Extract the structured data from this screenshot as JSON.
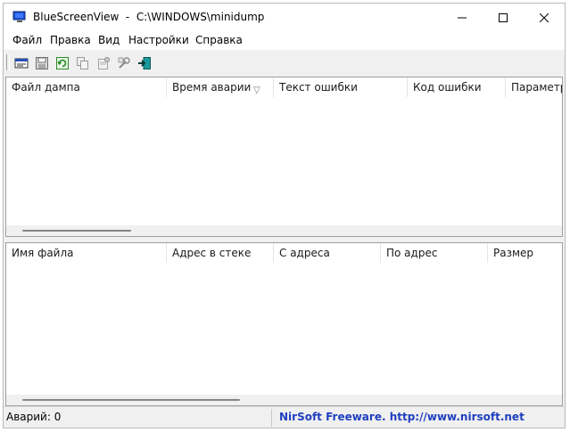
{
  "window": {
    "title": "BlueScreenView  -  C:\\WINDOWS\\minidump"
  },
  "menu": [
    "Файл",
    "Правка",
    "Вид",
    "Настройки",
    "Справка"
  ],
  "toolbar": {
    "buttons": [
      "html-report-icon",
      "save-icon",
      "refresh-icon",
      "copy-icon",
      "properties-icon",
      "advanced-options-icon",
      "exit-icon"
    ]
  },
  "top_table": {
    "columns": [
      "Файл дампа",
      "Время аварии",
      "Текст ошибки",
      "Код ошибки",
      "Параметр"
    ],
    "sort_indicator": "▽"
  },
  "bottom_table": {
    "columns": [
      "Имя файла",
      "Адрес в стеке",
      "С адреса",
      "По адрес",
      "Размер"
    ]
  },
  "status": {
    "crashes": "Аварий: 0",
    "credit": "NirSoft Freeware.  http://www.nirsoft.net"
  },
  "colors": {
    "credit_text": "#1f3fbf",
    "accent_icon": "#1f4fd0"
  }
}
